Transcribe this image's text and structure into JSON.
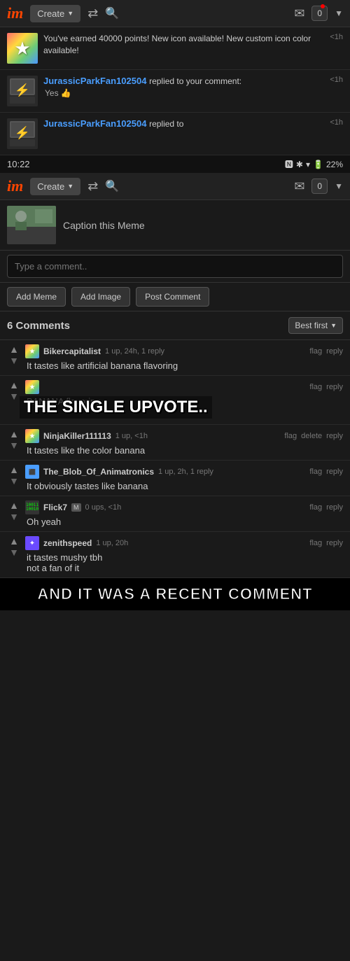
{
  "app": {
    "logo": "im",
    "create_label": "Create",
    "notification_count": "0"
  },
  "notifications": [
    {
      "type": "achievement",
      "text": "You've earned 40000 points! New icon available! New custom icon color available!",
      "time": "<1h"
    },
    {
      "type": "reply",
      "username": "JurassicParkFan102504",
      "action": "replied to your comment:",
      "comment": "Yes 👍",
      "time": "<1h"
    },
    {
      "type": "reply",
      "username": "JurassicParkFan102504",
      "action": "replied to",
      "time": "<1h"
    }
  ],
  "statusBar": {
    "time": "10:22",
    "battery": "22%"
  },
  "memeSection": {
    "caption_label": "Caption this Meme",
    "comment_placeholder": "Type a comment..",
    "add_meme_btn": "Add Meme",
    "add_image_btn": "Add Image",
    "post_comment_btn": "Post Comment"
  },
  "commentsSection": {
    "count_label": "6 Comments",
    "sort_label": "Best first"
  },
  "comments": [
    {
      "username": "Bikercapitalist",
      "avatar_type": "star-rainbow",
      "stats": "1 up, 24h, 1 reply",
      "text": "It tastes like artificial banana flavoring",
      "actions": [
        "flag",
        "reply"
      ]
    },
    {
      "username": "",
      "avatar_type": "star-rainbow",
      "stats": "",
      "text": "BANANA flavoring",
      "overlay_text": "THE SINGLE UPVOTE..",
      "actions": [
        "flag",
        "reply"
      ]
    },
    {
      "username": "NinjaKiller111113",
      "avatar_type": "star-rainbow",
      "stats": "1 up, <1h",
      "text": "It tastes like the color banana",
      "actions": [
        "flag",
        "delete",
        "reply"
      ]
    },
    {
      "username": "The_Blob_Of_Animatronics",
      "avatar_type": "pixel-blue",
      "stats": "1 up, 2h, 1 reply",
      "text": "It obviously tastes like banana",
      "actions": [
        "flag",
        "reply"
      ]
    },
    {
      "username": "Flick7",
      "avatar_type": "matrix",
      "badge": "M",
      "stats": "0 ups, <1h",
      "text": "Oh yeah",
      "actions": [
        "flag",
        "reply"
      ]
    },
    {
      "username": "zenithspeed",
      "avatar_type": "cross",
      "stats": "1 up, 20h",
      "text": "it tastes mushy tbh\nnot a fan of it",
      "actions": [
        "flag",
        "reply"
      ]
    }
  ],
  "bottom_banner": "AND IT WAS A RECENT COMMENT",
  "meme_overlay_text": "THE SINGLE UPVOTE..",
  "flag_label": "flag",
  "reply_label": "reply",
  "delete_label": "delete"
}
